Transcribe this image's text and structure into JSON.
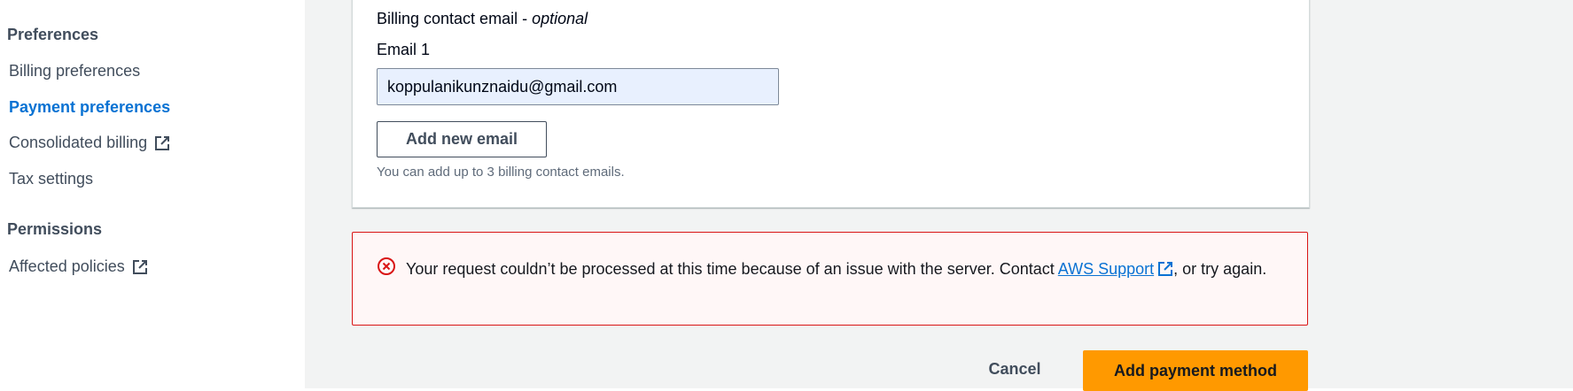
{
  "sidebar": {
    "preferences_heading": "Preferences",
    "items": [
      {
        "label": "Billing preferences"
      },
      {
        "label": "Payment preferences"
      },
      {
        "label": "Consolidated billing",
        "icon": "external-link-icon"
      },
      {
        "label": "Tax settings"
      }
    ],
    "permissions_heading": "Permissions",
    "permission_items": [
      {
        "label": "Affected policies",
        "icon": "external-link-icon"
      }
    ]
  },
  "form": {
    "contact_label": "Billing contact email - ",
    "contact_optional": "optional",
    "email_label": "Email 1",
    "email_value": "koppulanikunznaidu@gmail.com",
    "add_email_button": "Add new email",
    "hint": "You can add up to 3 billing contact emails."
  },
  "alert": {
    "icon": "error-circle-x-icon",
    "text_before": "Your request couldn’t be processed at this time because of an issue with the server. Contact ",
    "link_text": "AWS Support",
    "text_after": ", or try again."
  },
  "actions": {
    "cancel": "Cancel",
    "primary": "Add payment method"
  },
  "colors": {
    "accent_link": "#0972d3",
    "primary_button": "#ff9900",
    "error": "#d91515"
  }
}
